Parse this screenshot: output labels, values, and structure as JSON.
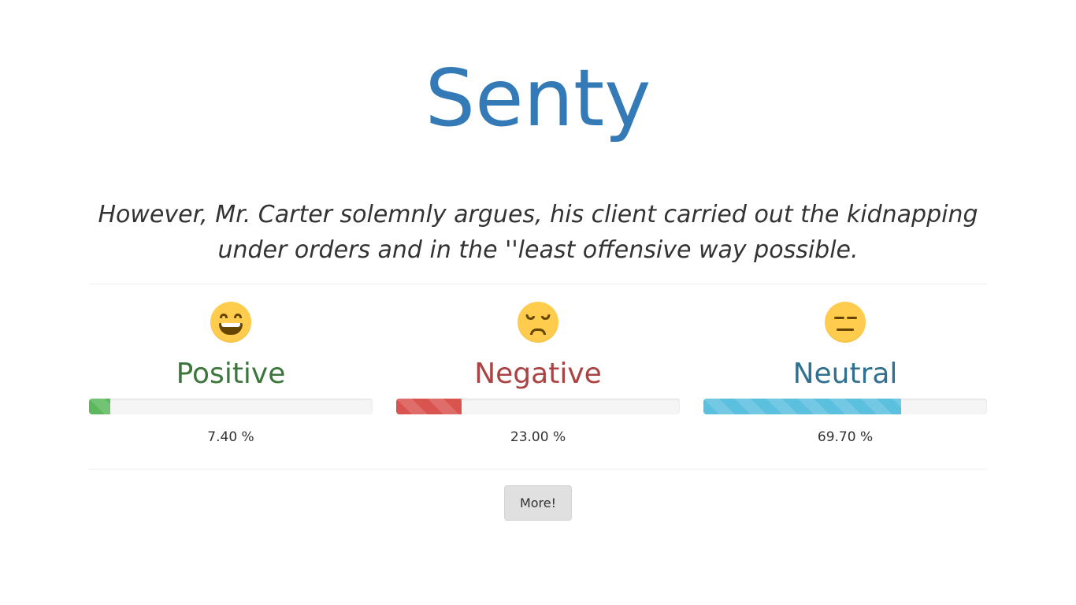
{
  "app": {
    "title": "Senty"
  },
  "sentence": "However, Mr. Carter solemnly argues, his client carried out the kidnapping under orders and in the ''least offensive way possible.",
  "results": [
    {
      "key": "positive",
      "label": "Positive",
      "percent": 7.4,
      "percent_text": "7.40 %",
      "icon": "grinning-face-icon",
      "color": "#5cb85c",
      "label_color": "#3c763d"
    },
    {
      "key": "negative",
      "label": "Negative",
      "percent": 23.0,
      "percent_text": "23.00 %",
      "icon": "unamused-face-icon",
      "color": "#d9534f",
      "label_color": "#a94442"
    },
    {
      "key": "neutral",
      "label": "Neutral",
      "percent": 69.7,
      "percent_text": "69.70 %",
      "icon": "expressionless-face-icon",
      "color": "#5bc0de",
      "label_color": "#31708f"
    }
  ],
  "more_button": {
    "label": "More!"
  }
}
